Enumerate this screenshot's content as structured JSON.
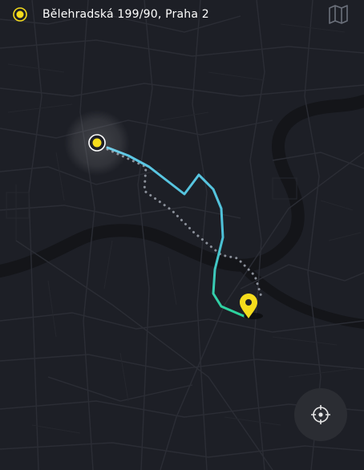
{
  "header": {
    "address": "Bělehradská 199/90, Praha 2",
    "origin_icon": "origin-dot-icon",
    "map_icon": "map-icon"
  },
  "route": {
    "travelled_color_start": "#5ec8e6",
    "travelled_color_end": "#2bd39b",
    "alternative_style": "dotted",
    "alternative_color": "#8a8f99"
  },
  "markers": {
    "origin_color": "#f5dc1c",
    "destination_color": "#f5dc1c",
    "destination_icon": "map-pin-icon"
  },
  "controls": {
    "locate_icon": "crosshair-icon"
  },
  "colors": {
    "background": "#1d1f26",
    "river": "#14151a",
    "roads": "#2c2e36",
    "accent": "#f5dc1c"
  }
}
